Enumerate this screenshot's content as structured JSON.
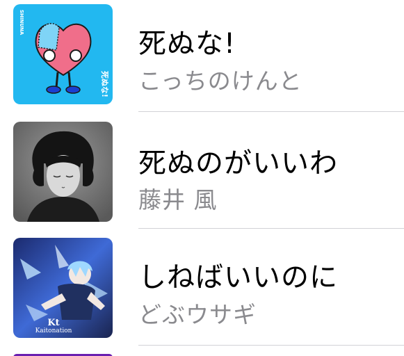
{
  "songs": [
    {
      "title": "死ぬな!",
      "artist": "こっちのけんと",
      "artwork": {
        "icon": "heart-character-artwork",
        "side_text": "SHINUNA",
        "corner_text": "死ぬな!",
        "colors": {
          "bg": "#22b8f0",
          "heart": "#f06e8a",
          "patch": "#7fd4f6"
        }
      }
    },
    {
      "title": "死ぬのがいいわ",
      "artist": "藤井 風",
      "artwork": {
        "icon": "portrait-photo-artwork",
        "colors": {
          "bg": "#6f6f6f"
        }
      }
    },
    {
      "title": "しねばいいのに",
      "artist": "どぶウサギ",
      "artwork": {
        "icon": "anime-character-artwork",
        "logo_text": "Kaitonation",
        "colors": {
          "bg": "#2a3f8f"
        }
      }
    },
    {
      "artwork": {
        "icon": "album-artwork",
        "colors": {
          "bg": "#6a1fb0"
        }
      }
    }
  ]
}
